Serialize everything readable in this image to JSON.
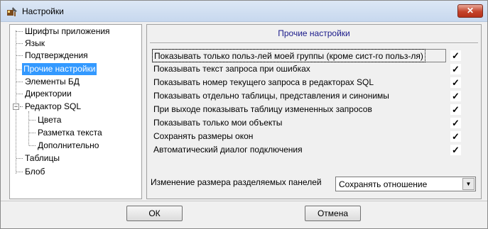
{
  "window": {
    "title": "Настройки",
    "close_label": "✕"
  },
  "tree": {
    "items": [
      {
        "label": "Шрифты приложения"
      },
      {
        "label": "Язык"
      },
      {
        "label": "Подтверждения"
      },
      {
        "label": "Прочие настройки",
        "selected": true
      },
      {
        "label": "Элементы БД"
      },
      {
        "label": "Директории"
      },
      {
        "label": "Редактор SQL",
        "expanded": true
      },
      {
        "label": "Цвета"
      },
      {
        "label": "Разметка текста"
      },
      {
        "label": "Дополнительно"
      },
      {
        "label": "Таблицы"
      },
      {
        "label": "Блоб"
      }
    ],
    "expander_glyph": "−"
  },
  "panel": {
    "title": "Прочие настройки",
    "options": [
      {
        "label": "Показывать только польз-лей моей группы (кроме сист-го польз-ля)",
        "checked": true
      },
      {
        "label": "Показывать текст запроса при ошибках",
        "checked": true
      },
      {
        "label": "Показывать номер текущего запроса в редакторах SQL",
        "checked": true
      },
      {
        "label": "Показывать отдельно таблицы, представления и синонимы",
        "checked": true
      },
      {
        "label": "При выходе показывать таблицу измененных запросов",
        "checked": true
      },
      {
        "label": "Показывать только мои объекты",
        "checked": true
      },
      {
        "label": "Сохранять размеры окон",
        "checked": true
      },
      {
        "label": "Автоматический диалог подключения",
        "checked": true
      }
    ],
    "check_glyph": "✓",
    "split_label": "Изменение размера разделяемых панелей",
    "split_value": "Сохранять отношение",
    "combo_arrow": "▼"
  },
  "buttons": {
    "ok": "ОК",
    "cancel": "Отмена"
  }
}
